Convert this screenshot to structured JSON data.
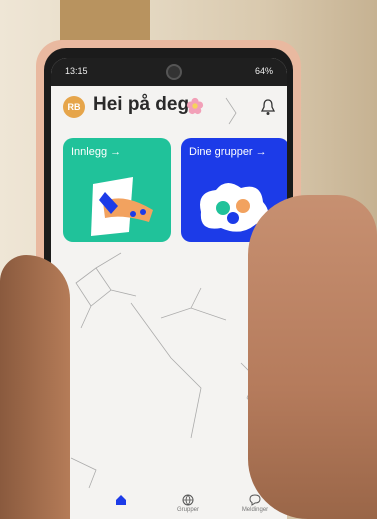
{
  "status_bar": {
    "time": "13:15",
    "battery": "64%"
  },
  "header": {
    "avatar_initials": "RB",
    "greeting": "Hei på deg"
  },
  "cards": [
    {
      "label": "Innlegg →",
      "color": "#20c29a"
    },
    {
      "label": "Dine grupper →",
      "color": "#1c3be8"
    }
  ],
  "bottom_nav": [
    {
      "label": "",
      "icon": "home-icon"
    },
    {
      "label": "Grupper",
      "icon": "globe-icon"
    },
    {
      "label": "Meldinger",
      "icon": "chat-icon"
    }
  ]
}
